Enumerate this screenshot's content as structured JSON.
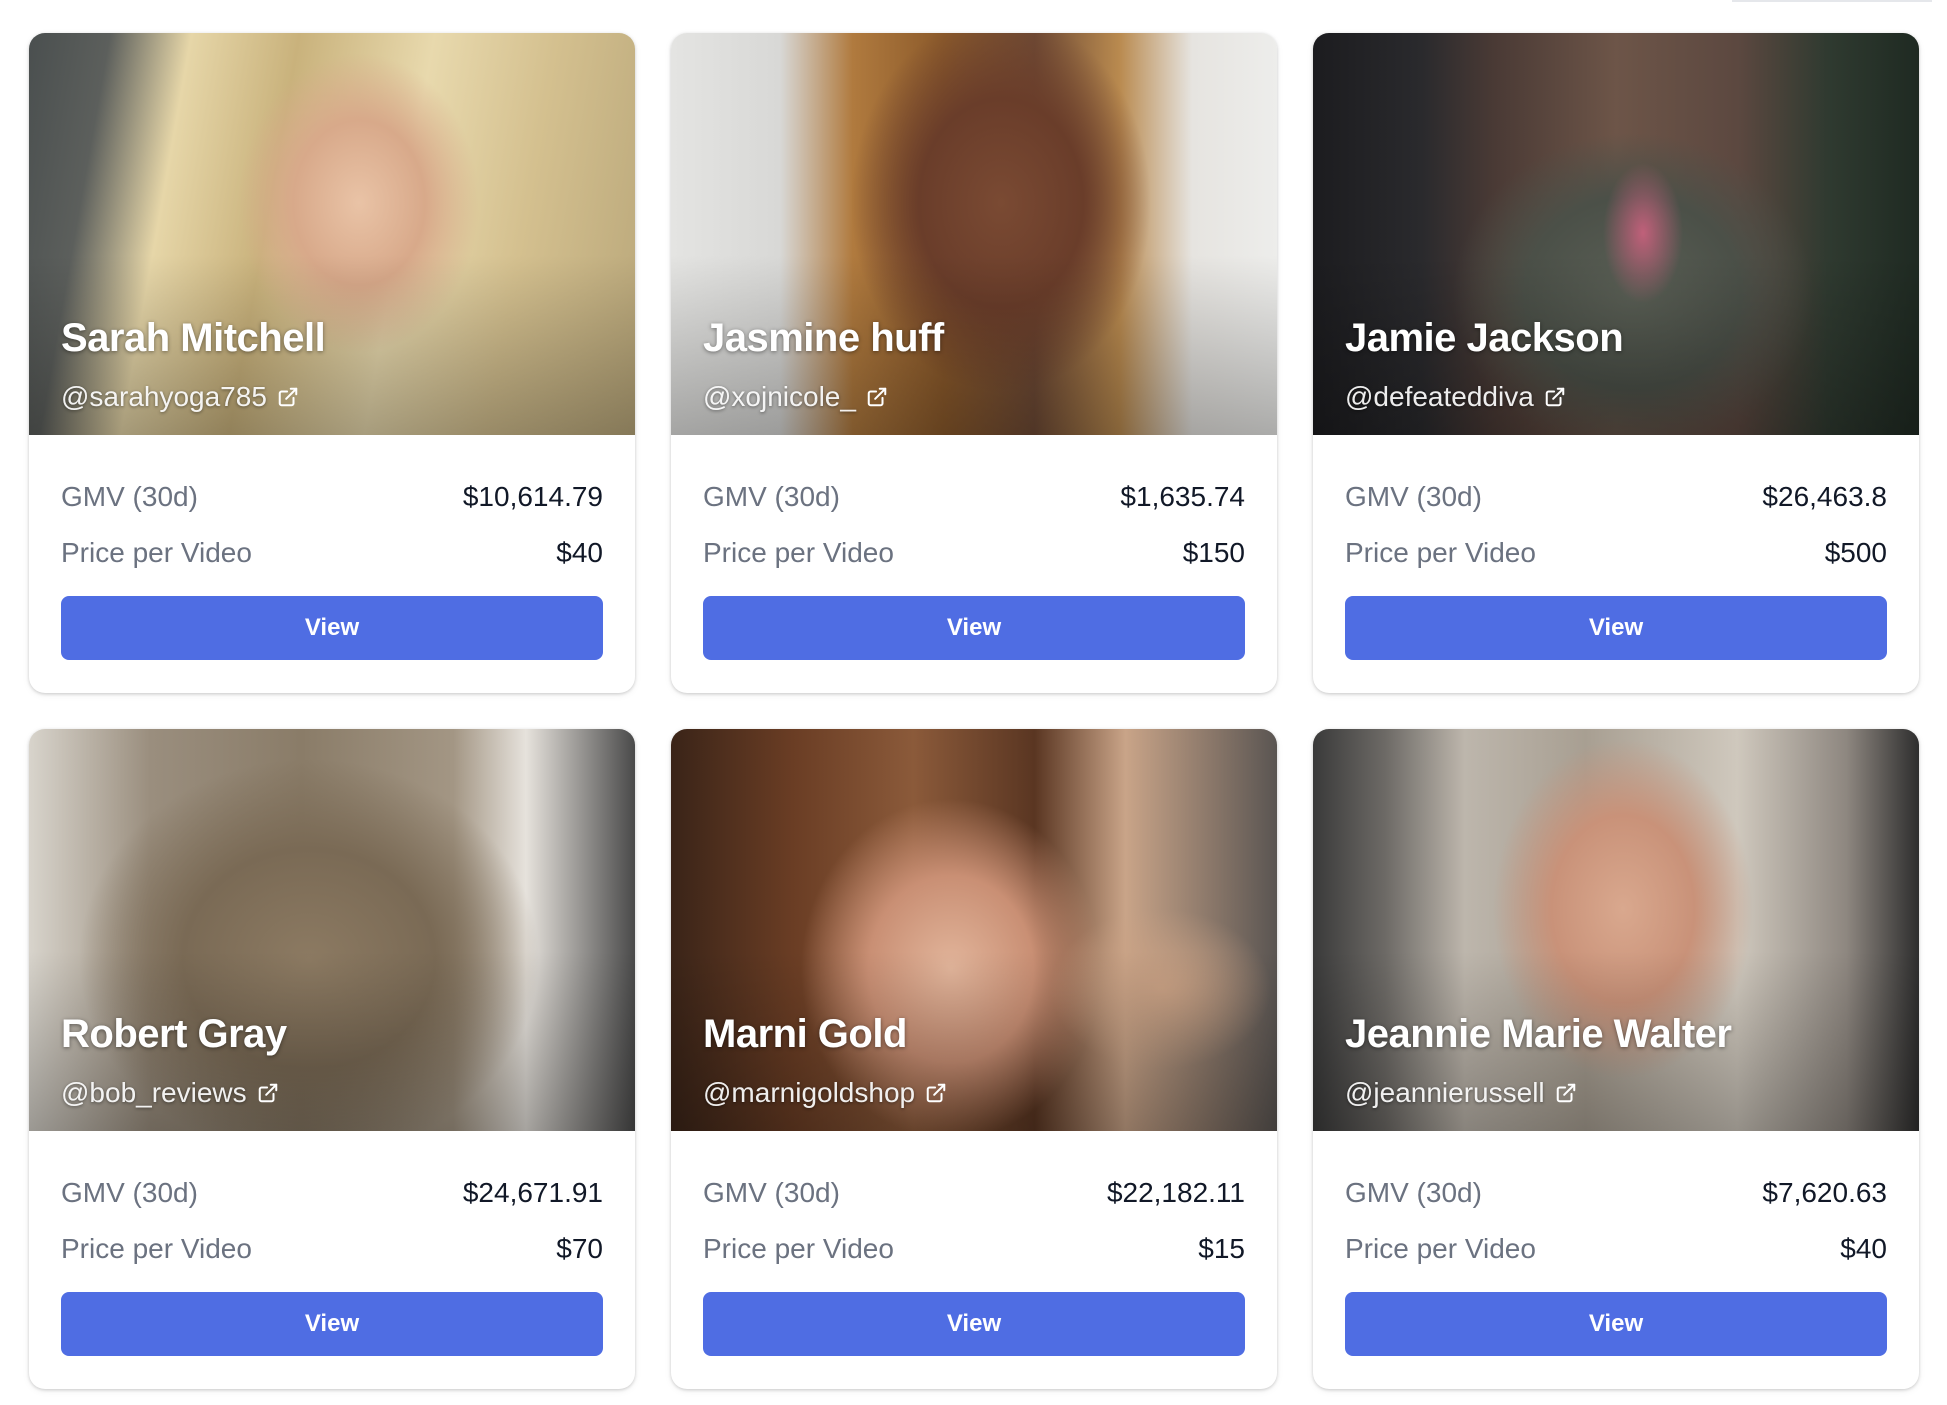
{
  "labels": {
    "gmv": "GMV (30d)",
    "price": "Price per Video",
    "view": "View"
  },
  "colors": {
    "button": "#4f6de3",
    "label_text": "#6b7280",
    "value_text": "#111827"
  },
  "creators": [
    {
      "name": "Sarah Mitchell",
      "handle": "@sarahyoga785",
      "gmv": "$10,614.79",
      "price": "$40"
    },
    {
      "name": "Jasmine huff",
      "handle": "@xojnicole_",
      "gmv": "$1,635.74",
      "price": "$150"
    },
    {
      "name": "Jamie Jackson",
      "handle": "@defeateddiva",
      "gmv": "$26,463.8",
      "price": "$500"
    },
    {
      "name": "Robert Gray",
      "handle": "@bob_reviews",
      "gmv": "$24,671.91",
      "price": "$70"
    },
    {
      "name": "Marni Gold",
      "handle": "@marnigoldshop",
      "gmv": "$22,182.11",
      "price": "$15"
    },
    {
      "name": "Jeannie Marie Walter",
      "handle": "@jeannierussell",
      "gmv": "$7,620.63",
      "price": "$40"
    }
  ]
}
